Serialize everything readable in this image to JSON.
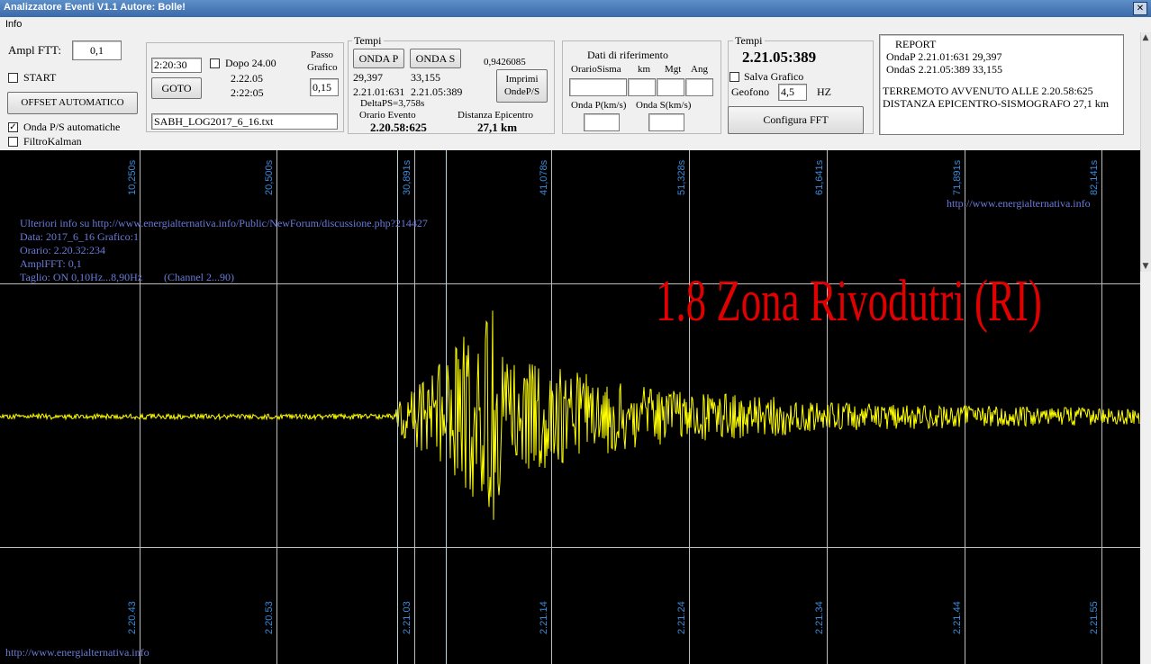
{
  "window": {
    "title": "Analizzatore Eventi V1.1  Autore: Bolle!",
    "close": "✕"
  },
  "menu": {
    "info": "Info"
  },
  "left": {
    "ampl_label": "Ampl FTT:",
    "ampl_value": "0,1",
    "start_label": "START",
    "start_checked": false,
    "offset_button": "OFFSET AUTOMATICO",
    "onde_label": "Onda  P/S automatiche",
    "onde_checked": true,
    "kalman_label": "FiltroKalman",
    "kalman_checked": false
  },
  "goto_panel": {
    "time_value": "2:20:30",
    "dopo_label": "Dopo 24.00",
    "dopo_checked": false,
    "time1": "2.22.05",
    "time2": "2:22:05",
    "goto_button": "GOTO",
    "passo_label_1": "Passo",
    "passo_label_2": "Grafico",
    "passo_value": "0,15",
    "file_value": "SABH_LOG2017_6_16.txt"
  },
  "tempi_panel": {
    "title": "Tempi",
    "onda_p_button": "ONDA P",
    "onda_s_button": "ONDA S",
    "ratio": "0,9426085",
    "p_value": "29,397",
    "s_value": "33,155",
    "p_time": "2.21.01:631",
    "s_time": "2.21.05:389",
    "imprimi_1": "Imprimi",
    "imprimi_2": "OndeP/S",
    "delta": "DeltaPS=3,758s",
    "orario_label": "Orario Evento",
    "distanza_label": "Distanza Epicentro",
    "orario_value": "2.20.58:625",
    "distanza_value": "27,1 km"
  },
  "riferimento_panel": {
    "title": "Dati di riferimento",
    "col_orario": "OrarioSisma",
    "col_km": "km",
    "col_mgt": "Mgt",
    "col_ang": "Ang",
    "onda_p_label": "Onda P(km/s)",
    "onda_s_label": "Onda S(km/s)"
  },
  "tempi2_panel": {
    "title": "Tempi",
    "value": "2.21.05:389",
    "salva_label": "Salva Grafico",
    "salva_checked": false,
    "geofono_label": "Geofono",
    "geofono_value": "4,5",
    "hz_label": "HZ",
    "fft_button": "Configura FFT"
  },
  "report": {
    "title": "REPORT",
    "line1": "OndaP 2.21.01:631 29,397",
    "line2": "OndaS 2.21.05:389 33,155",
    "line3": "TERREMOTO AVVENUTO ALLE 2.20.58:625",
    "line4": "DISTANZA EPICENTRO-SISMOGRAFO 27,1 km"
  },
  "plot": {
    "top_ticks": [
      "10,250s",
      "20,500s",
      "30,891s",
      "41,078s",
      "51,328s",
      "61,641s",
      "71,891s",
      "82,141s"
    ],
    "bottom_ticks": [
      "2.20.43",
      "2.20.53",
      "2.21.03",
      "2.21.14",
      "2.21.24",
      "2.21.34",
      "2.21.44",
      "2.21.55"
    ],
    "url_top": "http://www.energialternativa.info",
    "url_bottom": "http://www.energialternativa.info",
    "info_line1": "Ulteriori info su http://www.energialternativa.info/Public/NewForum/discussione.php?214427",
    "info_line2": "Data: 2017_6_16 Grafico:1",
    "info_line3": "Orario: 2.20.32:234",
    "info_line4": "AmplFFT: 0,1",
    "info_line5": "Taglio: ON 0,10Hz...8,90Hz",
    "info_channel": "(Channel 2...90)",
    "event_label": "1.8 Zona Rivodutri (RI)",
    "trace_color": "#ffff00",
    "background_color": "#000000",
    "label_color": "#e00000"
  }
}
